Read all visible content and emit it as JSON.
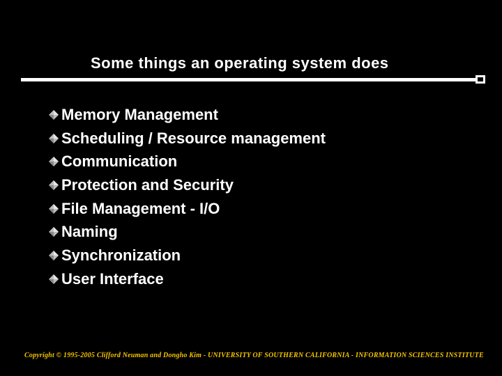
{
  "title": "Some things  an operating system does",
  "bullets": [
    "Memory Management",
    "Scheduling / Resource management",
    "Communication",
    "Protection and Security",
    "File Management - I/O",
    "Naming",
    "Synchronization",
    "User Interface"
  ],
  "footer": "Copyright © 1995-2005 Clifford Neuman and Dongho Kim - UNIVERSITY OF SOUTHERN CALIFORNIA - INFORMATION SCIENCES INSTITUTE",
  "colors": {
    "bullet_fill": "#bdbdbd",
    "bullet_edge": "#e6e6e6",
    "footer": "#f5c400"
  }
}
